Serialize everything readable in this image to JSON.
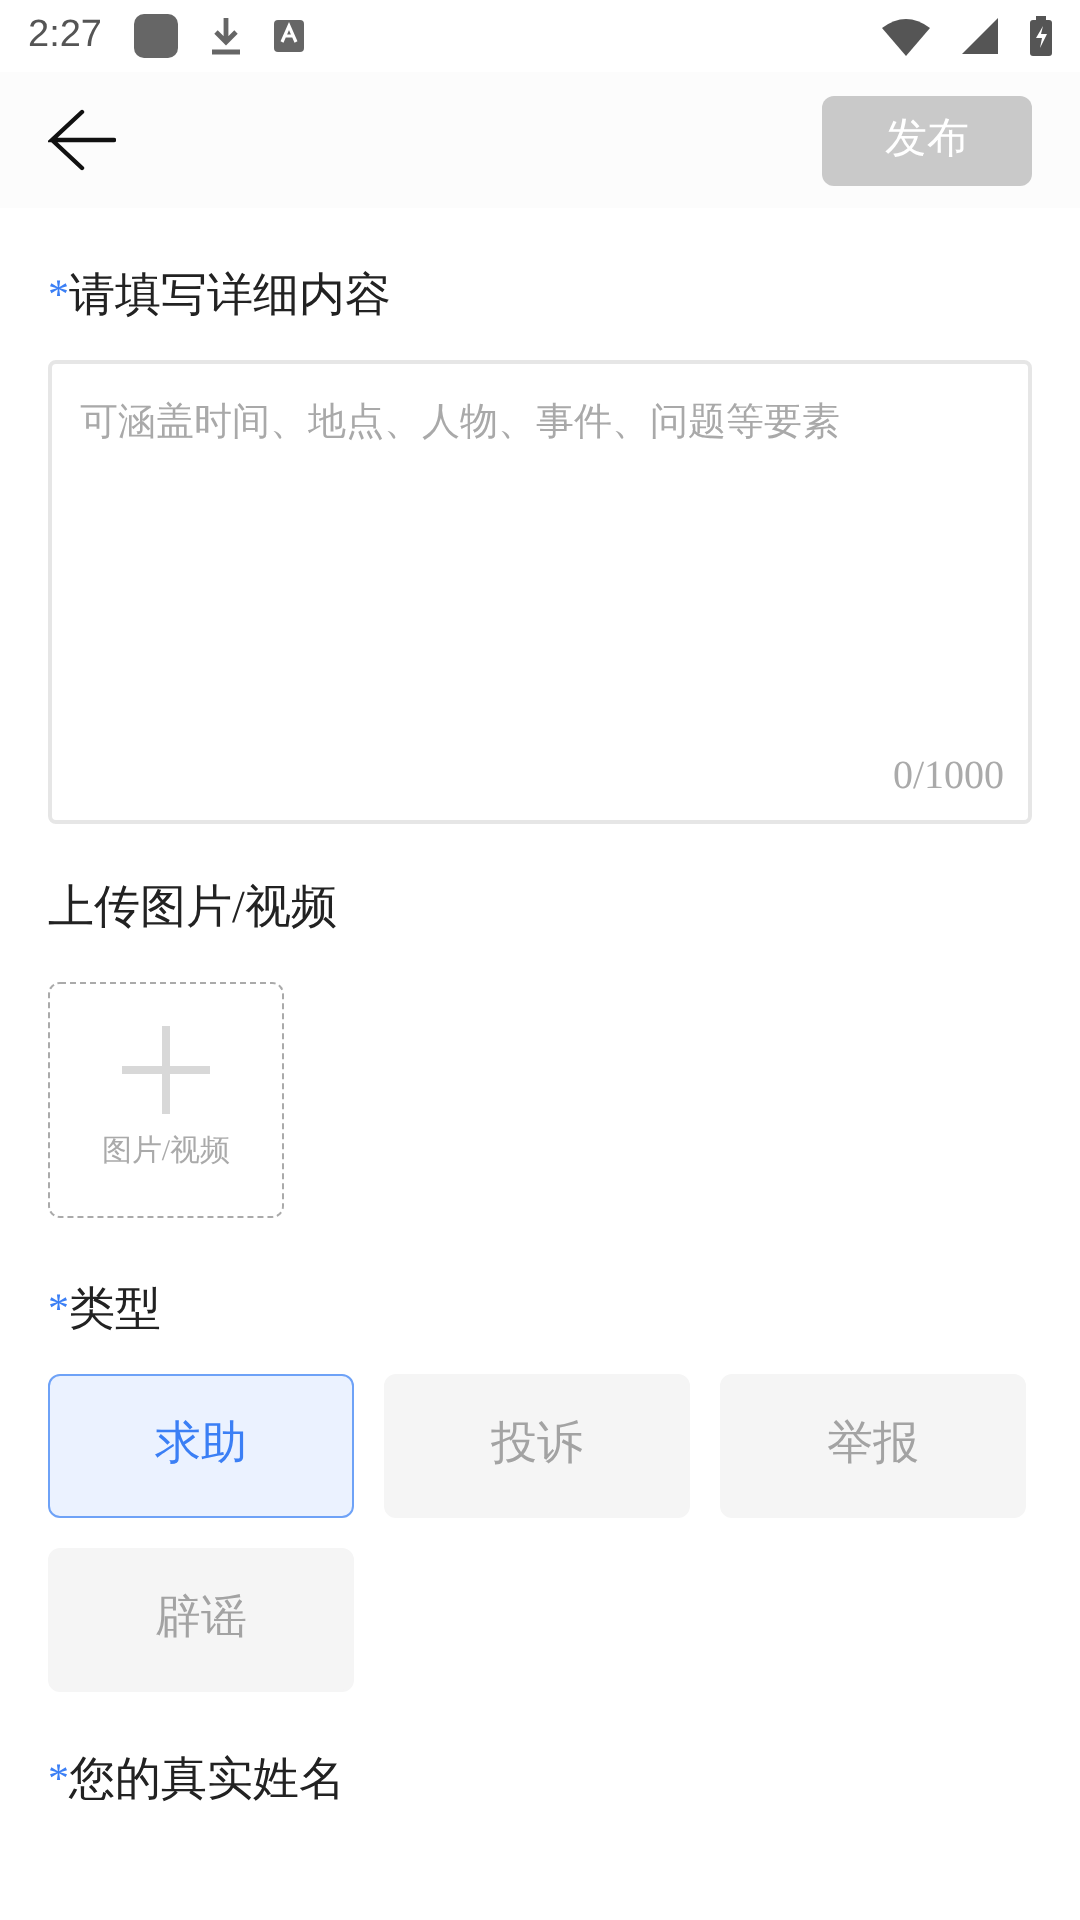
{
  "status_bar": {
    "time": "2:27"
  },
  "header": {
    "publish_button": {
      "label": "发布",
      "disabled": true
    }
  },
  "sections": [
    {
      "kind": "textarea",
      "required_mark": "*",
      "label": "请填写详细内容",
      "placeholder": "可涵盖时间、地点、人物、事件、问题等要素",
      "counter": "0/1000"
    },
    {
      "kind": "upload",
      "label": "上传图片/视频",
      "tile_label": "图片/视频"
    },
    {
      "kind": "types",
      "required_mark": "*",
      "label": "类型",
      "options": [
        {
          "label": "求助",
          "selected": true
        },
        {
          "label": "投诉",
          "selected": false
        },
        {
          "label": "举报",
          "selected": false
        },
        {
          "label": "辟谣",
          "selected": false
        }
      ]
    },
    {
      "kind": "heading",
      "required_mark": "*",
      "label": "您的真实姓名"
    }
  ]
}
